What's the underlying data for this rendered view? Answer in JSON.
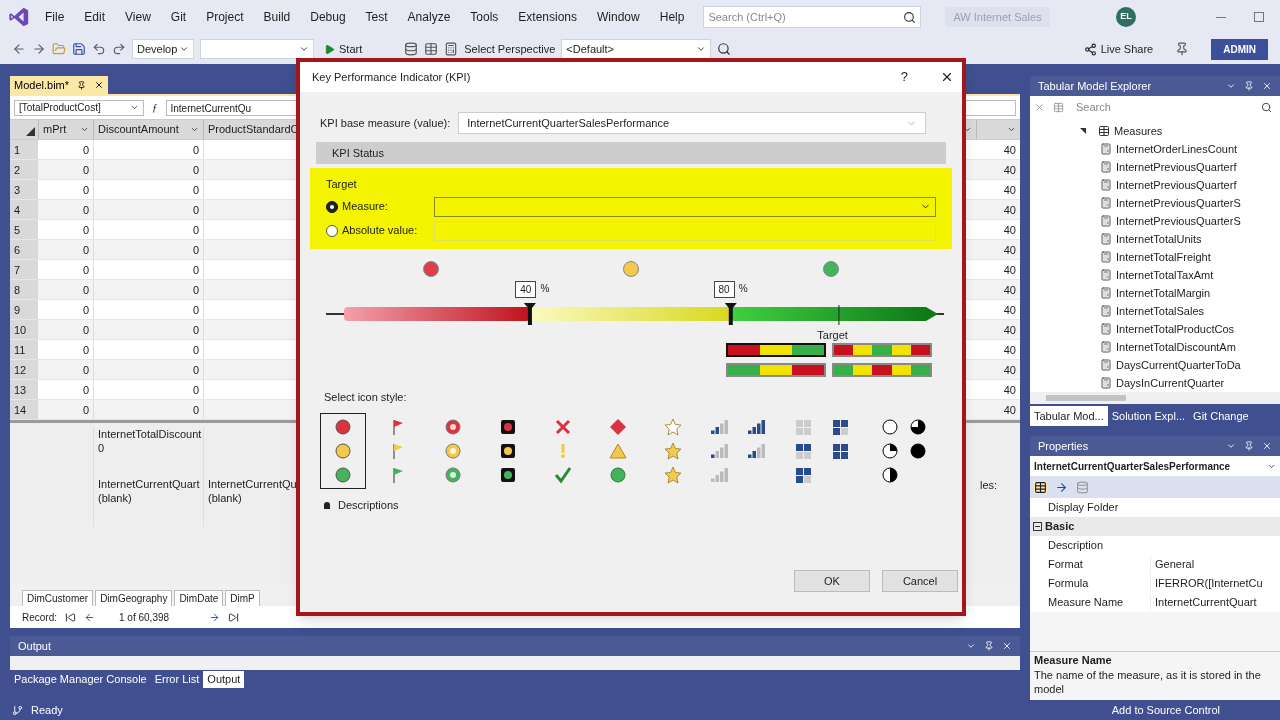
{
  "menu_bar": {
    "items": [
      "File",
      "Edit",
      "View",
      "Git",
      "Project",
      "Build",
      "Debug",
      "Test",
      "Analyze",
      "Tools",
      "Extensions",
      "Window",
      "Help"
    ],
    "search": {
      "placeholder": "Search (Ctrl+Q)"
    },
    "solution_name": "AW Internet Sales",
    "avatar": "EL"
  },
  "toolbar": {
    "configuration": "Develop",
    "start": "Start",
    "perspective_label": "Select Perspective",
    "perspective": "<Default>",
    "live_share": "Live Share",
    "admin": "ADMIN"
  },
  "document": {
    "tab": {
      "label": "Model.bim*",
      "selected": true
    },
    "column_select": "[TotalProductCost]",
    "function_symbol": "ƒ",
    "formula": "InternetCurrentQu",
    "columns": [
      "mPrt",
      "DiscountAmount",
      "ProductStandardC"
    ],
    "rows": [
      {
        "number": "1",
        "cells": [
          "0",
          "0"
        ],
        "column_far": "40"
      },
      {
        "number": "2",
        "cells": [
          "0",
          "0"
        ],
        "column_far": "40"
      },
      {
        "number": "3",
        "cells": [
          "0",
          "0"
        ],
        "column_far": "40"
      },
      {
        "number": "4",
        "cells": [
          "0",
          "0"
        ],
        "column_far": "40"
      },
      {
        "number": "5",
        "cells": [
          "0",
          "0"
        ],
        "column_far": "40"
      },
      {
        "number": "6",
        "cells": [
          "0",
          "0"
        ],
        "column_far": "40"
      },
      {
        "number": "7",
        "cells": [
          "0",
          "0"
        ],
        "column_far": "40"
      },
      {
        "number": "8",
        "cells": [
          "0",
          "0"
        ],
        "column_far": "40"
      },
      {
        "number": "9",
        "cells": [
          "0",
          "0"
        ],
        "column_far": "40"
      },
      {
        "number": "10",
        "cells": [
          "0",
          "0"
        ],
        "column_far": "40"
      },
      {
        "number": "11",
        "cells": [
          "0",
          "0"
        ],
        "column_far": "40"
      },
      {
        "number": "12",
        "cells": [
          "0",
          "0"
        ],
        "column_far": "40"
      },
      {
        "number": "13",
        "cells": [
          "0",
          "0"
        ],
        "column_far": "40"
      },
      {
        "number": "14",
        "cells": [
          "0",
          "0"
        ],
        "column_far": "40"
      }
    ],
    "measure_rows": [
      {
        "column_2": {
          "name": "InternetTotalDiscount",
          "value": "0"
        }
      },
      {
        "column_2": {
          "name": "InternetCurrentQuart",
          "value": "(blank)"
        },
        "column_3": {
          "name": "InternetCurrentQu",
          "value": "(blank)"
        },
        "column_far": "les:"
      }
    ],
    "sheet_tabs": [
      "DimCustomer",
      "DimGeography",
      "DimDate",
      "DimP"
    ],
    "record": {
      "label": "Record:",
      "position": "1 of 60,398"
    }
  },
  "output": {
    "title": "Output",
    "tabs": [
      {
        "label": "Package Manager Console",
        "selected": false
      },
      {
        "label": "Error List",
        "selected": false
      },
      {
        "label": "Output",
        "selected": true
      }
    ]
  },
  "explorer": {
    "title": "Tabular Model Explorer",
    "search": {
      "placeholder": "Search"
    },
    "tree": [
      {
        "label": "Measures",
        "expanded": true,
        "children": [
          {
            "label": "InternetOrderLinesCount"
          },
          {
            "label": "InternetPreviousQuarterf"
          },
          {
            "label": "InternetPreviousQuarterf"
          },
          {
            "label": "InternetPreviousQuarterS"
          },
          {
            "label": "InternetPreviousQuarterS"
          },
          {
            "label": "InternetTotalUnits"
          },
          {
            "label": "InternetTotalFreight"
          },
          {
            "label": "InternetTotalTaxAmt"
          },
          {
            "label": "InternetTotalMargin"
          },
          {
            "label": "InternetTotalSales"
          },
          {
            "label": "InternetTotalProductCos"
          },
          {
            "label": "InternetTotalDiscountAm"
          },
          {
            "label": "DaysCurrentQuarterToDa"
          },
          {
            "label": "DaysInCurrentQuarter"
          }
        ]
      }
    ],
    "tabs": [
      {
        "label": "Tabular Mod...",
        "selected": true
      },
      {
        "label": "Solution Expl...",
        "selected": false
      },
      {
        "label": "Git Change",
        "selected": false
      }
    ]
  },
  "properties": {
    "title": "Properties",
    "object": "InternetCurrentQuarterSalesPerformance",
    "rows": [
      {
        "kind": "property",
        "name": "Display Folder"
      },
      {
        "kind": "category",
        "name": "Basic",
        "expanded": true
      },
      {
        "kind": "property",
        "name": "Description"
      },
      {
        "kind": "property",
        "name": "Format",
        "value": "General"
      },
      {
        "kind": "property",
        "name": "Formula",
        "value": "IFERROR([InternetCu"
      },
      {
        "kind": "property",
        "name": "Measure Name",
        "value": "InternetCurrentQuart"
      }
    ],
    "description": {
      "title": "Measure Name",
      "text": "The name of the measure, as it is stored in the model"
    }
  },
  "status_bar": {
    "text": "Ready",
    "source_control": "Add to Source Control"
  },
  "dialog": {
    "title": "Key Performance Indicator (KPI)",
    "help": "?",
    "base_measure": {
      "label": "KPI base measure (value):",
      "value": "InternetCurrentQuarterSalesPerformance"
    },
    "section": "KPI Status",
    "target": {
      "title": "Target",
      "options": [
        {
          "label": "Measure:",
          "selected": true
        },
        {
          "label": "Absolute value:",
          "selected": false
        }
      ]
    },
    "status_icons": [
      {
        "color": "#d9404c"
      },
      {
        "color": "#f2c94c"
      },
      {
        "color": "#45b35c"
      }
    ],
    "thresholds": [
      {
        "value": "40",
        "unit": "%",
        "level": 0.33
      },
      {
        "value": "80",
        "unit": "%",
        "level": 0.655
      }
    ],
    "target_marker": {
      "label": "Target",
      "level": 0.83
    },
    "band_styles": [
      {
        "kind": "ascending",
        "selected": true
      },
      {
        "kind": "centered",
        "selected": false
      },
      {
        "kind": "descending",
        "selected": false
      },
      {
        "kind": "spread",
        "selected": false
      }
    ],
    "icon_style_label": "Select icon style:",
    "icon_styles": [
      {
        "kind": "circles",
        "selected": true
      },
      {
        "kind": "flags",
        "selected": false
      },
      {
        "kind": "badges",
        "selected": false
      },
      {
        "kind": "lights",
        "selected": false
      },
      {
        "kind": "symbols",
        "selected": false
      },
      {
        "kind": "shapes",
        "selected": false
      },
      {
        "kind": "stars",
        "selected": false
      },
      {
        "kind": "signal",
        "selected": false
      },
      {
        "kind": "signalfull",
        "selected": false
      },
      {
        "kind": "quadrant",
        "selected": false
      },
      {
        "kind": "quadrantfull",
        "selected": false
      },
      {
        "kind": "pie",
        "selected": false
      },
      {
        "kind": "piefull",
        "selected": false
      }
    ],
    "descriptions": {
      "label": "Descriptions",
      "expanded": false
    },
    "buttons": [
      "OK",
      "Cancel"
    ]
  }
}
